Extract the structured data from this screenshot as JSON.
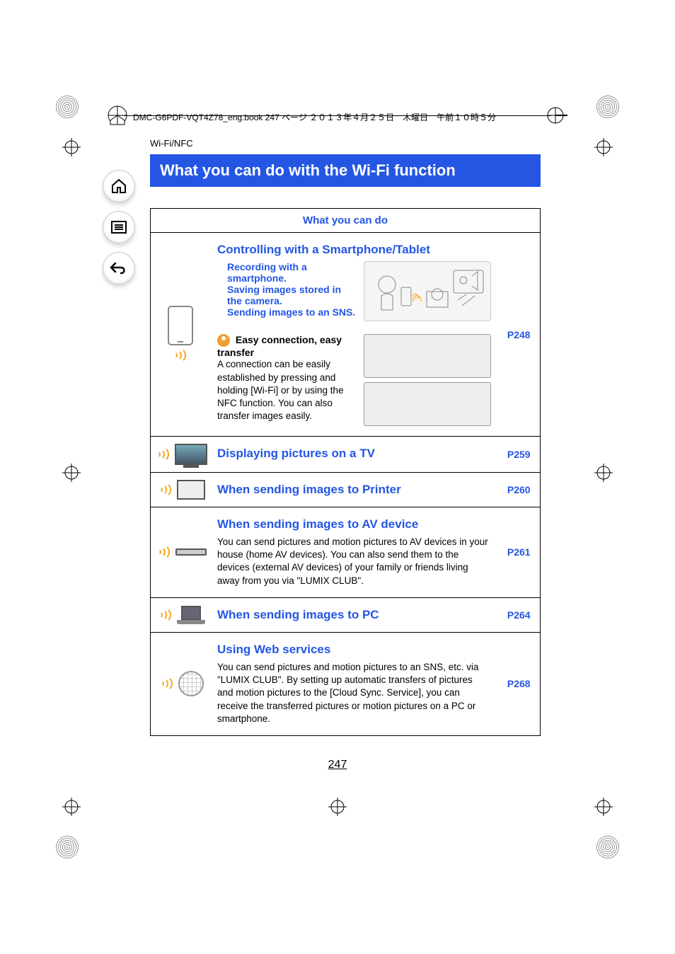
{
  "header": {
    "filename_line": "DMC-G6PDF-VQT4Z78_eng.book  247 ページ  ２０１３年４月２５日　木曜日　午前１０時５分"
  },
  "section_label": "Wi-Fi/NFC",
  "section_title": "What you can do with the Wi-Fi function",
  "table_header": "What you can do",
  "rows": {
    "r1": {
      "heading": "Controlling with a Smartphone/Tablet",
      "bullet1": "Recording with a smartphone.",
      "bullet2": "Saving images stored in the camera.",
      "bullet3": "Sending images to an SNS.",
      "tip_title": "Easy connection, easy transfer",
      "tip_body": "A connection can be easily established by pressing and holding [Wi-Fi] or by using the NFC function. You can also transfer images easily.",
      "page": "P248"
    },
    "r2": {
      "heading": "Displaying pictures on a TV",
      "page": "P259"
    },
    "r3": {
      "heading": "When sending images to Printer",
      "page": "P260"
    },
    "r4": {
      "heading": "When sending images to AV device",
      "body": "You can send pictures and motion pictures to AV devices in your house (home AV devices). You can also send them to the devices (external AV devices) of your family or friends living away from you via \"LUMIX CLUB\".",
      "page": "P261"
    },
    "r5": {
      "heading": "When sending images to PC",
      "page": "P264"
    },
    "r6": {
      "heading": "Using Web services",
      "body": "You can send pictures and motion pictures to an SNS, etc. via \"LUMIX CLUB\". By setting up automatic transfers of pictures and motion pictures to the [Cloud Sync. Service], you can receive the transferred pictures or motion pictures on a PC or smartphone.",
      "page": "P268"
    }
  },
  "page_number": "247"
}
